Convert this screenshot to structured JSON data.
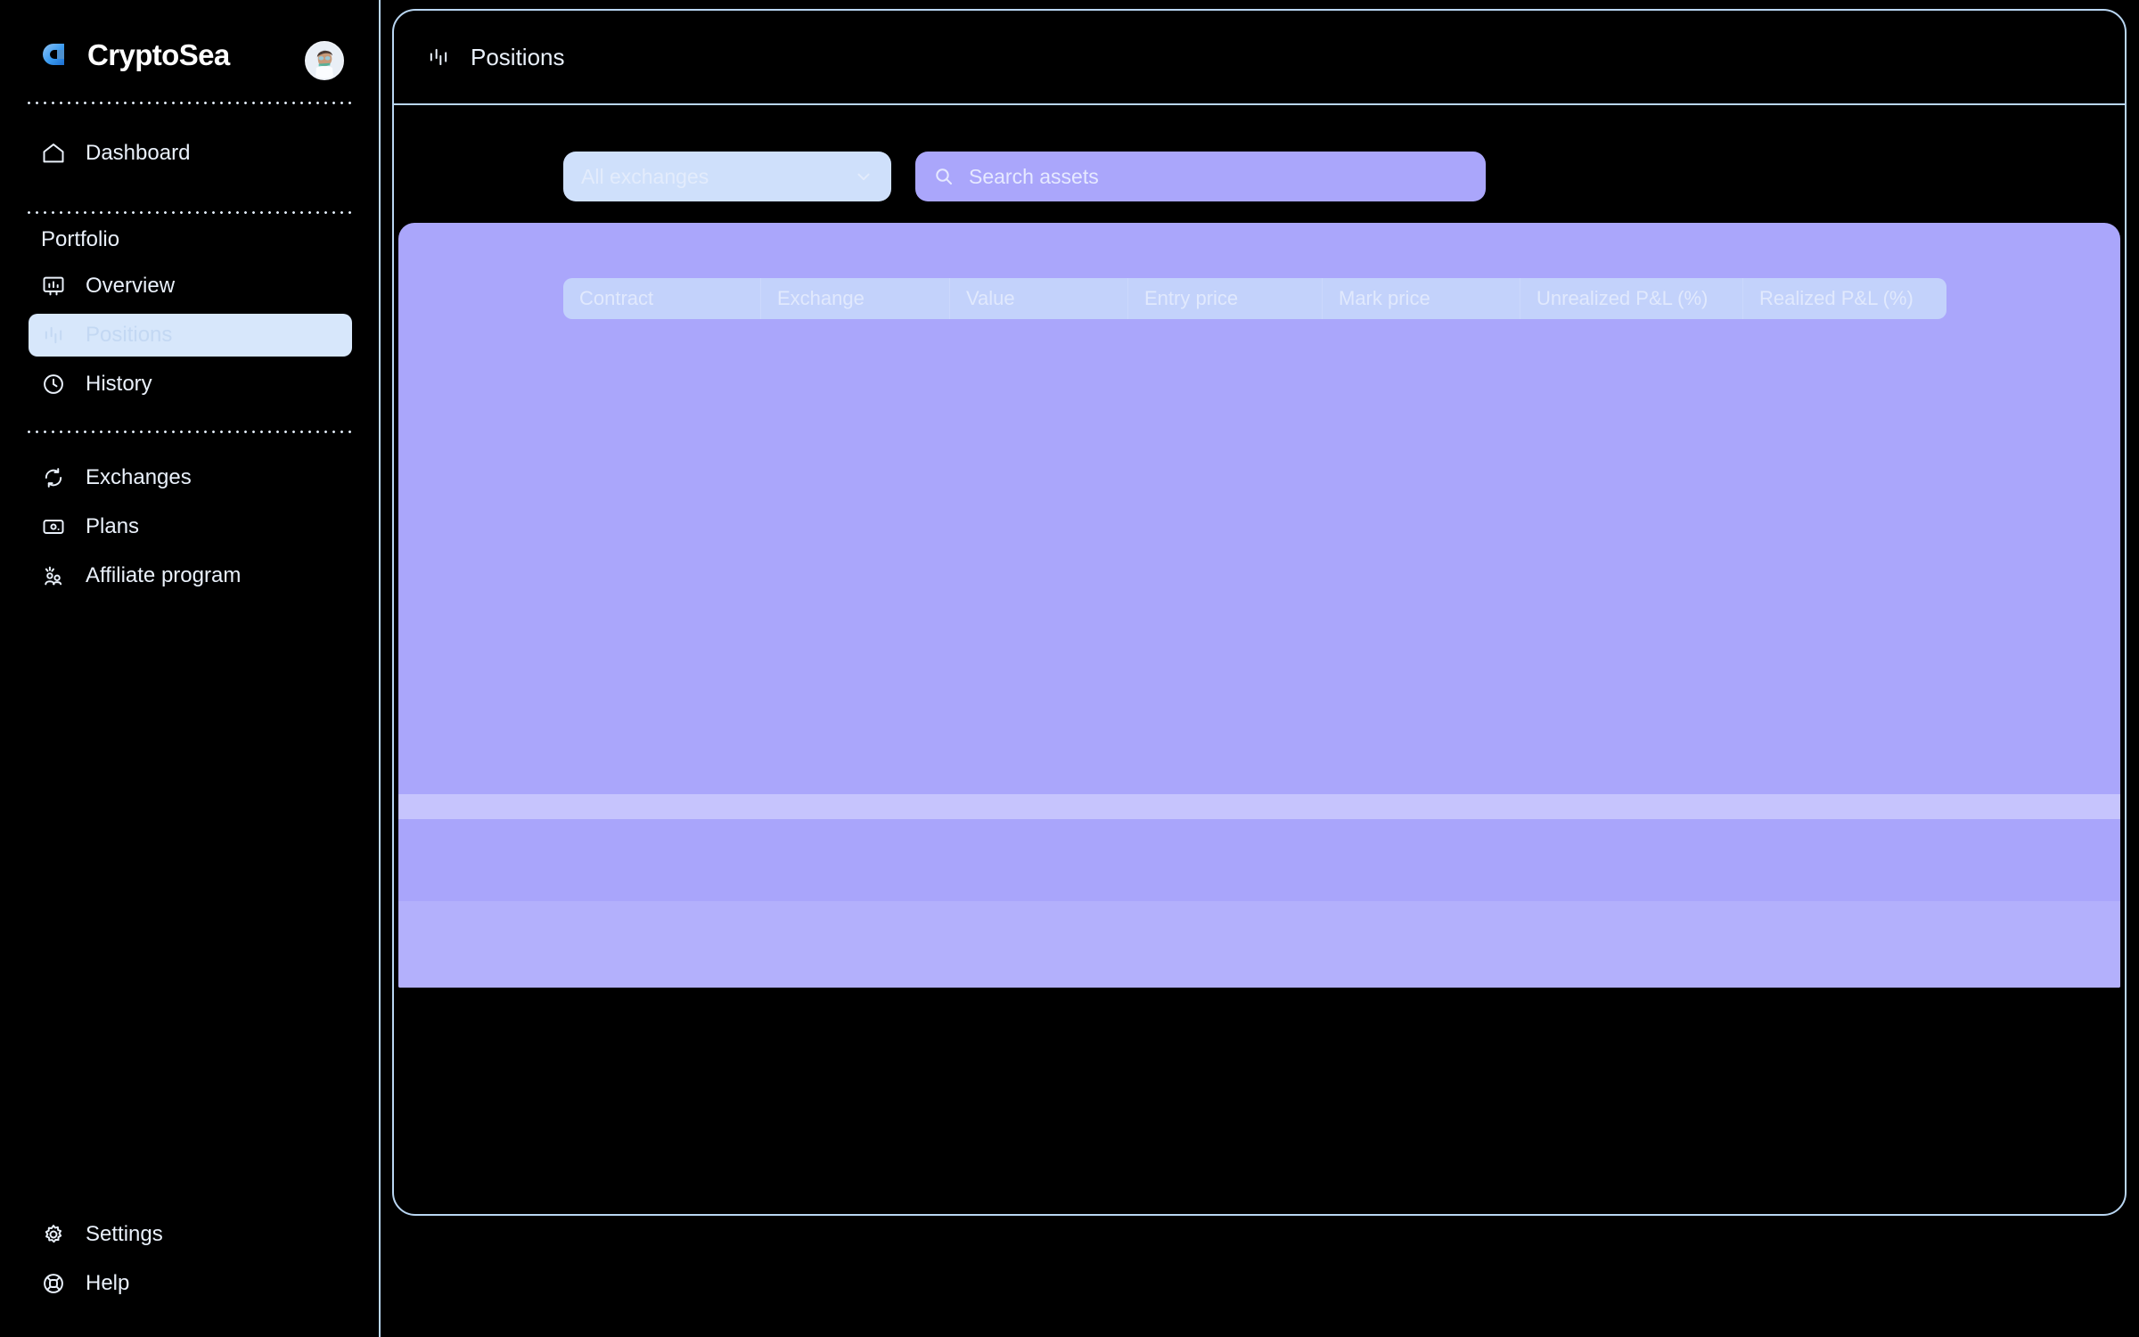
{
  "brand": {
    "name": "CryptoSea",
    "logo_icon": "cryptosea-logo-icon",
    "avatar_icon": "user-avatar"
  },
  "colors": {
    "background": "#000000",
    "border": "#b9d6f2",
    "text": "#eaf1fb",
    "accent_blue": "#cfe0fb",
    "accent_purple": "#aaa6fb",
    "active_nav_bg": "#d7e7fb",
    "table_header_bg": "#c3d2fb",
    "band_light": "#c6c4fd",
    "band_mid": "#a9a5fb"
  },
  "sidebar": {
    "section_label": "Portfolio",
    "top_items": [
      {
        "label": "Dashboard",
        "icon": "home-icon",
        "active": false
      }
    ],
    "portfolio_items": [
      {
        "label": "Overview",
        "icon": "chart-board-icon",
        "active": false
      },
      {
        "label": "Positions",
        "icon": "bar-chart-icon",
        "active": true
      },
      {
        "label": "History",
        "icon": "clock-icon",
        "active": false
      }
    ],
    "other_items": [
      {
        "label": "Exchanges",
        "icon": "refresh-exchange-icon",
        "active": false
      },
      {
        "label": "Plans",
        "icon": "card-plan-icon",
        "active": false
      },
      {
        "label": "Affiliate program",
        "icon": "affiliate-people-icon",
        "active": false
      }
    ],
    "bottom_items": [
      {
        "label": "Settings",
        "icon": "gear-icon",
        "active": false
      },
      {
        "label": "Help",
        "icon": "lifebuoy-icon",
        "active": false
      }
    ]
  },
  "main": {
    "header": {
      "title": "Positions",
      "icon": "bar-chart-icon"
    },
    "filters": {
      "exchange_select": {
        "value": "All exchanges",
        "chevron_icon": "chevron-down-icon"
      },
      "search": {
        "value": "",
        "placeholder": "Search assets",
        "icon": "search-icon"
      }
    },
    "table": {
      "columns": [
        "Contract",
        "Exchange",
        "Value",
        "Entry price",
        "Mark price",
        "Unrealized P&L (%)",
        "Realized P&L (%)"
      ],
      "rows": []
    }
  }
}
